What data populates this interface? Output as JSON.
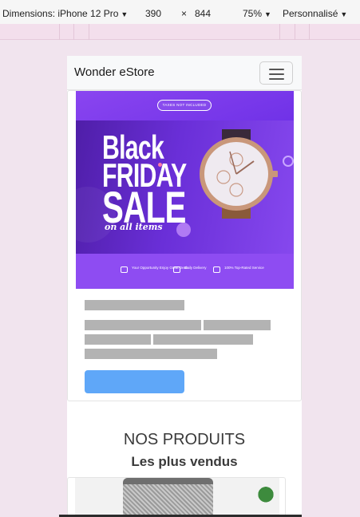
{
  "devtools": {
    "device_label": "Dimensions: iPhone 12 Pro",
    "width": "390",
    "times": "×",
    "height": "844",
    "zoom": "75%",
    "throttle": "Personnalisé"
  },
  "navbar": {
    "brand": "Wonder eStore"
  },
  "banner": {
    "pill": "TAXES NOT INCLUDED",
    "line1": "Black",
    "line2": "FRIDAY",
    "line3": "SALE",
    "line4": "on all items",
    "features": [
      {
        "text": "Your Opportunity Enjoy Great Deals"
      },
      {
        "text": "Daily Delivery"
      },
      {
        "text": "100% Top-Rated Service"
      }
    ]
  },
  "section": {
    "title": "NOS PRODUITS",
    "subtitle": "Les plus vendus"
  },
  "colors": {
    "page_bg": "#f1e4ee",
    "banner_purple": "#7b3fea",
    "placeholder_gray": "#b3b3b3",
    "button_blue": "#5fa7f8"
  }
}
